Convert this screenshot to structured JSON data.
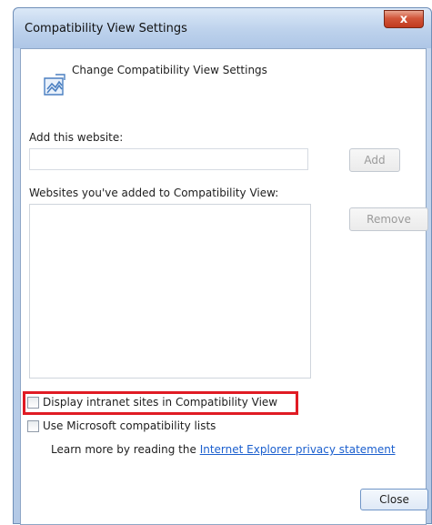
{
  "window": {
    "title": "Compatibility View Settings",
    "close_symbol": "x"
  },
  "header": {
    "icon": "compatibility-view-icon",
    "label": "Change Compatibility View Settings"
  },
  "add_site": {
    "label": "Add this website:",
    "value": "",
    "button_label": "Add"
  },
  "list": {
    "label": "Websites you've added to Compatibility View:",
    "items": [],
    "remove_label": "Remove"
  },
  "options": {
    "intranet_label": "Display intranet sites in Compatibility View",
    "intranet_checked": false,
    "ms_lists_label": "Use Microsoft compatibility lists",
    "ms_lists_checked": false
  },
  "footer": {
    "learn_more_prefix": "Learn more by reading the ",
    "privacy_link": "Internet Explorer privacy statement",
    "close_label": "Close"
  },
  "colors": {
    "highlight": "#e01b24",
    "link": "#1b5fce"
  }
}
